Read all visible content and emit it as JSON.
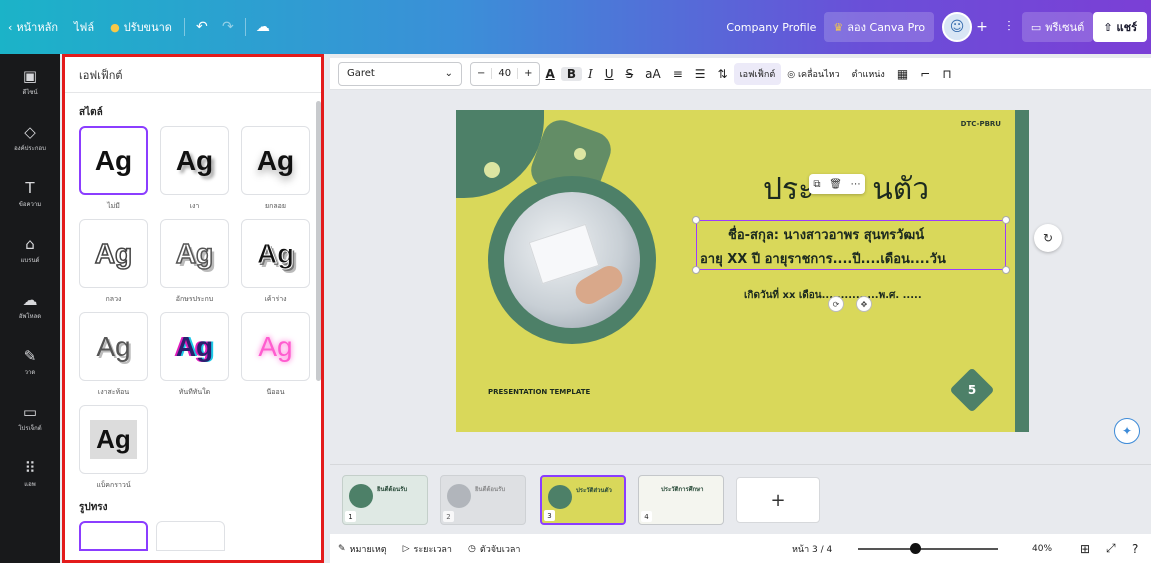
{
  "topbar": {
    "home": "หน้าหลัก",
    "file": "ไฟล์",
    "resize": "ปรับขนาด",
    "doc_title": "Company Profile",
    "try_pro": "ลอง Canva Pro",
    "present": "พรีเซนต์",
    "share": "แชร์"
  },
  "rail": [
    {
      "label": "ดีไซน์",
      "icon": "layout-icon"
    },
    {
      "label": "องค์ประกอบ",
      "icon": "shapes-icon"
    },
    {
      "label": "ข้อความ",
      "icon": "text-icon"
    },
    {
      "label": "แบรนด์",
      "icon": "brand-icon"
    },
    {
      "label": "อัพโหลด",
      "icon": "upload-icon"
    },
    {
      "label": "วาด",
      "icon": "draw-icon"
    },
    {
      "label": "โปรเจ็กต์",
      "icon": "folder-icon"
    },
    {
      "label": "แอพ",
      "icon": "apps-icon"
    }
  ],
  "panel": {
    "header": "เอฟเฟ็กต์",
    "style_title": "สไตล์",
    "shape_title": "รูปทรง",
    "effects": [
      {
        "sample": "Ag",
        "label": "ไม่มี"
      },
      {
        "sample": "Ag",
        "label": "เงา"
      },
      {
        "sample": "Ag",
        "label": "ยกลอย"
      },
      {
        "sample": "Ag",
        "label": "กลวง"
      },
      {
        "sample": "Ag",
        "label": "อักษรประกบ"
      },
      {
        "sample": "Ag",
        "label": "เค้าร่าง"
      },
      {
        "sample": "Ag",
        "label": "เงาสะท้อน"
      },
      {
        "sample": "Ag",
        "label": "ทันทีทันใด"
      },
      {
        "sample": "Ag",
        "label": "นีออน"
      },
      {
        "sample": "Ag",
        "label": "แบ็คกราวน์"
      }
    ]
  },
  "toolbar": {
    "font": "Garet",
    "size": "40",
    "effects": "เอฟเฟ็กต์",
    "animate": "เคลื่อนไหว",
    "position": "ตำแหน่ง"
  },
  "slide": {
    "brand": "DTC-PBRU",
    "title_left": "ประ",
    "title_right": "นตัว",
    "line1": "ชื่อ-สกุล: นางสาวอาพร สุนทรวัฒน์",
    "line2": "อายุ  XX  ปี อายุราชการ....ปี....เดือน....วัน",
    "line3": "เกิดวันที่ xx เดือน...............พ.ศ. .....",
    "template": "PRESENTATION TEMPLATE",
    "page": "5"
  },
  "pages": {
    "thumbs": [
      {
        "num": "1",
        "text": "ยินดีต้อนรับ"
      },
      {
        "num": "2",
        "text": "ยินดีต้อนรับ"
      },
      {
        "num": "3",
        "text": "ประวัติส่วนตัว"
      },
      {
        "num": "4",
        "text": "ประวัติการศึกษา"
      }
    ]
  },
  "bottombar": {
    "notes": "หมายเหตุ",
    "duration": "ระยะเวลา",
    "timer": "ตัวจับเวลา",
    "page_indicator": "หน้า 3 / 4",
    "zoom": "40%"
  },
  "colors": {
    "accent": "#8b3dff",
    "slide_bg": "#d9d85a",
    "slide_green": "#4d8068",
    "highlight_border": "#e31b1b"
  }
}
